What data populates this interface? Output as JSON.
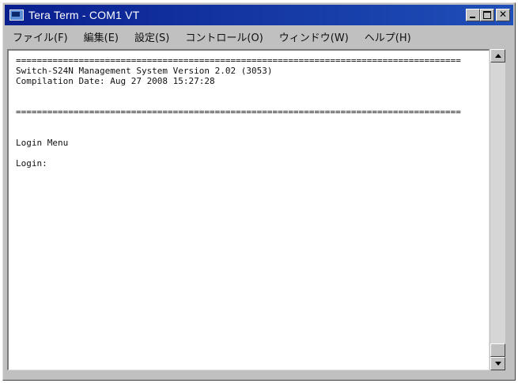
{
  "window": {
    "title": "Tera Term - COM1 VT",
    "app_icon": "teraterm-icon"
  },
  "menu": [
    {
      "label": "ファイル(F)"
    },
    {
      "label": "編集(E)"
    },
    {
      "label": "設定(S)"
    },
    {
      "label": "コントロール(O)"
    },
    {
      "label": "ウィンドウ(W)"
    },
    {
      "label": "ヘルプ(H)"
    }
  ],
  "terminal": {
    "lines": [
      "=====================================================================================",
      "Switch-S24N Management System Version 2.02 (3053)",
      "Compilation Date: Aug 27 2008 15:27:28",
      "",
      "",
      "=====================================================================================",
      "",
      "",
      "Login Menu",
      "",
      "Login:"
    ]
  }
}
